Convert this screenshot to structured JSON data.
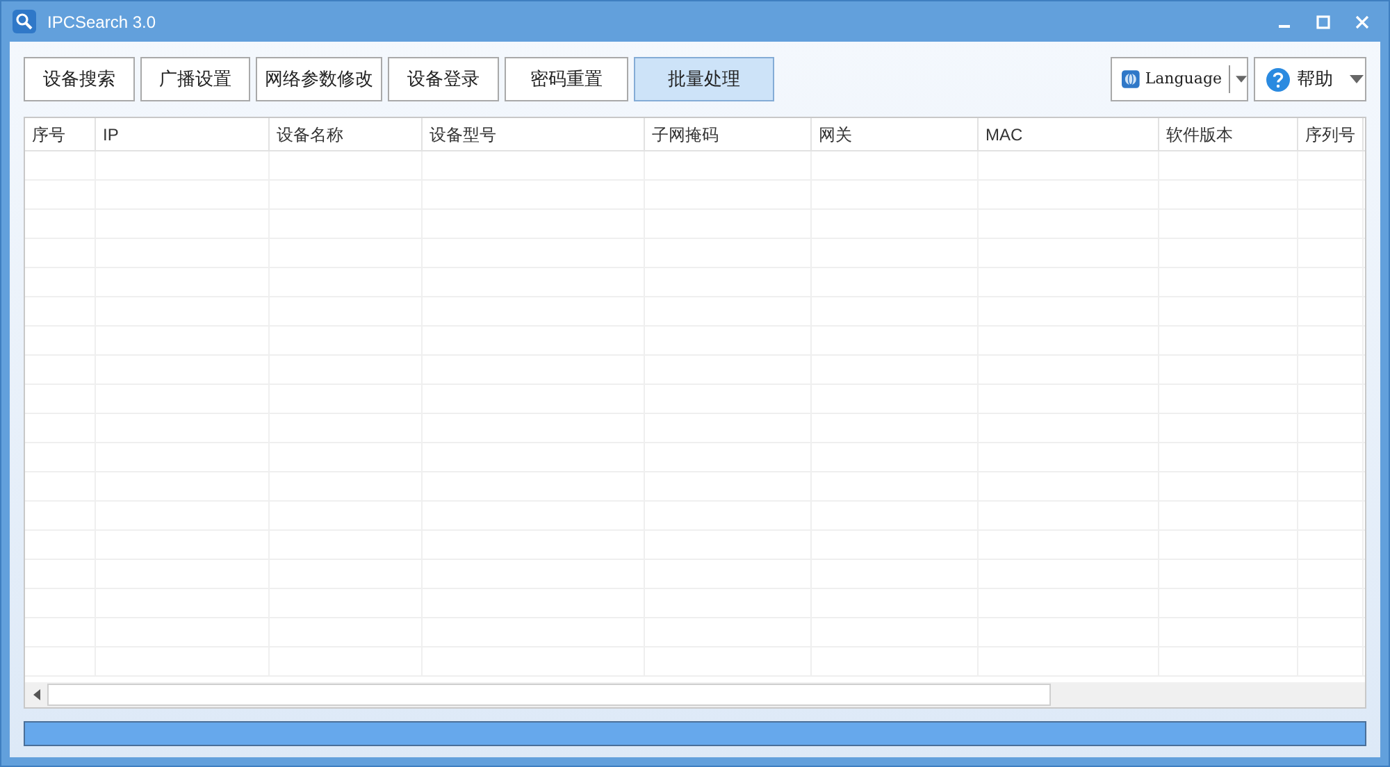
{
  "window": {
    "title": "IPCSearch 3.0"
  },
  "toolbar": {
    "buttons": [
      {
        "label": "设备搜索",
        "selected": false
      },
      {
        "label": "广播设置",
        "selected": false
      },
      {
        "label": "网络参数修改",
        "selected": false
      },
      {
        "label": "设备登录",
        "selected": false
      },
      {
        "label": "密码重置",
        "selected": false
      },
      {
        "label": "批量处理",
        "selected": true
      }
    ],
    "language": {
      "label": "Language"
    },
    "help": {
      "label": "帮助"
    }
  },
  "table": {
    "columns": [
      "序号",
      "IP",
      "设备名称",
      "设备型号",
      "子网掩码",
      "网关",
      "MAC",
      "软件版本",
      "序列号"
    ]
  },
  "progress": {
    "level": 1
  }
}
